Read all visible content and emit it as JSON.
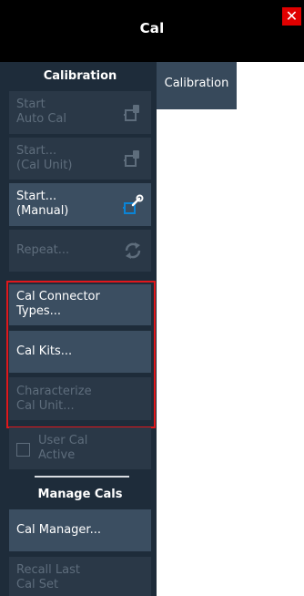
{
  "window": {
    "title": "Cal",
    "close_glyph": "✕"
  },
  "tab": {
    "label": "Calibration"
  },
  "calibration_section": {
    "heading": "Calibration",
    "buttons": [
      {
        "label": "Start\nAuto Cal",
        "enabled": false,
        "icon": "calibration-unit-icon"
      },
      {
        "label": "Start...\n(Cal Unit)",
        "enabled": false,
        "icon": "calibration-unit-icon"
      },
      {
        "label": "Start...\n(Manual)",
        "enabled": true,
        "icon": "manual-calibration-wrench-icon"
      },
      {
        "label": "Repeat...",
        "enabled": false,
        "icon": "repeat-arrows-icon"
      },
      {
        "label": "Cal Connector\nTypes...",
        "enabled": true
      },
      {
        "label": "Cal Kits...",
        "enabled": true
      },
      {
        "label": "Characterize\nCal Unit...",
        "enabled": false
      },
      {
        "label": "User Cal\nActive",
        "enabled": false,
        "checked": false
      }
    ]
  },
  "manage_section": {
    "heading": "Manage Cals",
    "buttons": [
      {
        "label": "Cal Manager...",
        "enabled": true
      },
      {
        "label": "Recall Last\nCal Set",
        "enabled": false
      }
    ]
  },
  "colors": {
    "panel": "#1e2c3a",
    "button": "#3b4e61",
    "button_disabled": "#2a3847",
    "disabled_text": "#5e6d7c",
    "highlight": "#e0171b",
    "close_button": "#e00000",
    "calibration_accent": "#0a84d6"
  }
}
